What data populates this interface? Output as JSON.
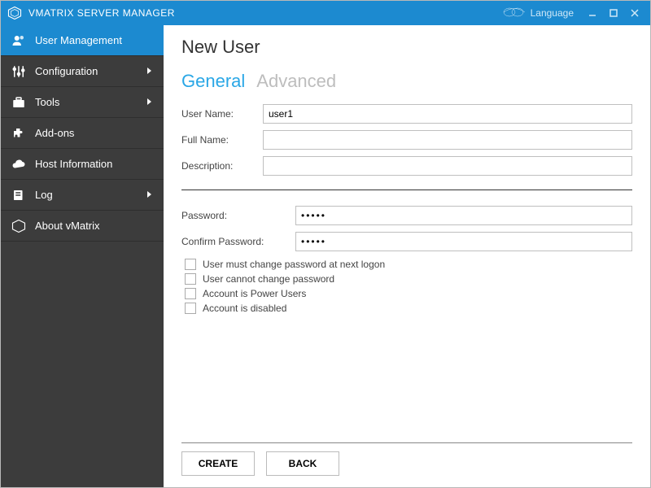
{
  "titlebar": {
    "app_title": "VMATRIX SERVER MANAGER",
    "language_label": "Language"
  },
  "sidebar": {
    "items": [
      {
        "label": "User Management",
        "has_submenu": false
      },
      {
        "label": "Configuration",
        "has_submenu": true
      },
      {
        "label": "Tools",
        "has_submenu": true
      },
      {
        "label": "Add-ons",
        "has_submenu": false
      },
      {
        "label": "Host Information",
        "has_submenu": false
      },
      {
        "label": "Log",
        "has_submenu": true
      },
      {
        "label": "About vMatrix",
        "has_submenu": false
      }
    ]
  },
  "page": {
    "title": "New User",
    "tabs": {
      "general": "General",
      "advanced": "Advanced"
    },
    "fields": {
      "username_label": "User Name:",
      "username_value": "user1",
      "fullname_label": "Full Name:",
      "fullname_value": "",
      "description_label": "Description:",
      "description_value": "",
      "password_label": "Password:",
      "password_value": "•••••",
      "confirm_label": "Confirm Password:",
      "confirm_value": "•••••"
    },
    "checks": {
      "change_next_logon": "User must change password at next logon",
      "cannot_change": "User cannot change password",
      "power_users": "Account is Power Users",
      "disabled": "Account is disabled"
    },
    "buttons": {
      "create": "CREATE",
      "back": "BACK"
    }
  }
}
